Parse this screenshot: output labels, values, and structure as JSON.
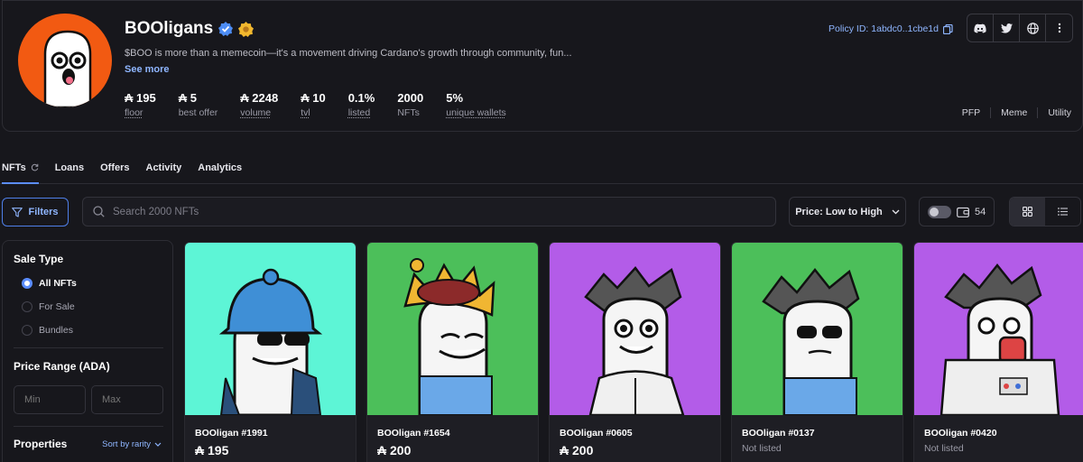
{
  "collection": {
    "name": "BOOligans",
    "description": "$BOO is more than a memecoin—it's a movement driving Cardano's growth through community, fun...",
    "see_more": "See more",
    "policy_id": "Policy ID: 1abdc0..1cbe1d"
  },
  "stats": [
    {
      "value": "₳ 195",
      "label": "floor"
    },
    {
      "value": "₳ 5",
      "label": "best offer"
    },
    {
      "value": "₳ 2248",
      "label": "volume"
    },
    {
      "value": "₳ 10",
      "label": "tvl"
    },
    {
      "value": "0.1%",
      "label": "listed"
    },
    {
      "value": "2000",
      "label": "NFTs"
    },
    {
      "value": "5%",
      "label": "unique wallets"
    }
  ],
  "socials": [
    "discord-icon",
    "twitter-icon",
    "globe-icon",
    "more-icon"
  ],
  "categories": [
    "PFP",
    "Meme",
    "Utility"
  ],
  "tabs": [
    "NFTs",
    "Loans",
    "Offers",
    "Activity",
    "Analytics"
  ],
  "toolbar": {
    "filters_label": "Filters",
    "search_placeholder": "Search 2000 NFTs",
    "sort_label": "Price: Low to High",
    "wallet_count": "54"
  },
  "sidebar": {
    "sale_type_title": "Sale Type",
    "sale_options": [
      "All NFTs",
      "For Sale",
      "Bundles"
    ],
    "selected_sale_option": "All NFTs",
    "price_range_title": "Price Range (ADA)",
    "min_placeholder": "Min",
    "max_placeholder": "Max",
    "properties_title": "Properties",
    "sort_by_rarity": "Sort by rarity"
  },
  "nfts": [
    {
      "name": "BOOligan #1991",
      "price": "₳ 195",
      "status": "",
      "bg": "#5df5d6"
    },
    {
      "name": "BOOligan #1654",
      "price": "₳ 200",
      "status": "",
      "bg": "#4cbf5a"
    },
    {
      "name": "BOOligan #0605",
      "price": "₳ 200",
      "status": "",
      "bg": "#b35ce8"
    },
    {
      "name": "BOOligan #0137",
      "price": "",
      "status": "Not listed",
      "bg": "#4cbf5a"
    },
    {
      "name": "BOOligan #0420",
      "price": "",
      "status": "Not listed",
      "bg": "#b35ce8"
    }
  ],
  "colors": {
    "accent": "#5b8dff",
    "link": "#8fb6ff",
    "avatar_bg": "#f25a12"
  }
}
